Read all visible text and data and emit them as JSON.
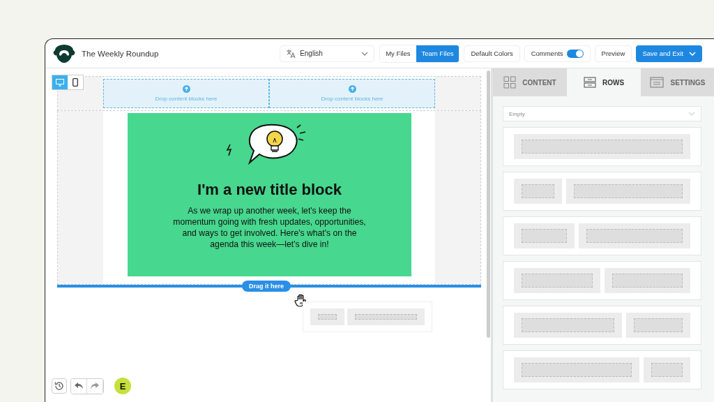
{
  "header": {
    "title": "The Weekly Roundup",
    "language": "English",
    "file_tabs": [
      {
        "label": "My Files",
        "selected": false
      },
      {
        "label": "Team Files",
        "selected": true
      }
    ],
    "default_colors": "Default Colors",
    "comments": {
      "label": "Comments",
      "on": true
    },
    "preview": "Preview",
    "save": "Save and Exit"
  },
  "devices": [
    {
      "kind": "desktop",
      "selected": true
    },
    {
      "kind": "mobile",
      "selected": false
    }
  ],
  "canvas": {
    "drop_zones": [
      "Drop content blocks here",
      "Drop content blocks here"
    ],
    "title": "I'm a new title block",
    "body": "As we wrap up another week, let's keep the momentum going with fresh updates, opportunities, and ways to get involved. Here's what's on the agenda this week—let's dive in!",
    "drag_label": "Drag it here",
    "dragged_row": {
      "kind": "quarter-left"
    },
    "avatar": "E"
  },
  "panel": {
    "tabs": [
      {
        "label": "CONTENT",
        "kind": "content",
        "selected": false
      },
      {
        "label": "ROWS",
        "kind": "rows",
        "selected": true
      },
      {
        "label": "SETTINGS",
        "kind": "settings",
        "selected": false
      }
    ],
    "filter": "Empty",
    "layouts": [
      {
        "kind": "full"
      },
      {
        "kind": "quarter-left"
      },
      {
        "kind": "third-left"
      },
      {
        "kind": "halves"
      },
      {
        "kind": "third-right"
      },
      {
        "kind": "quarter-right"
      }
    ]
  }
}
